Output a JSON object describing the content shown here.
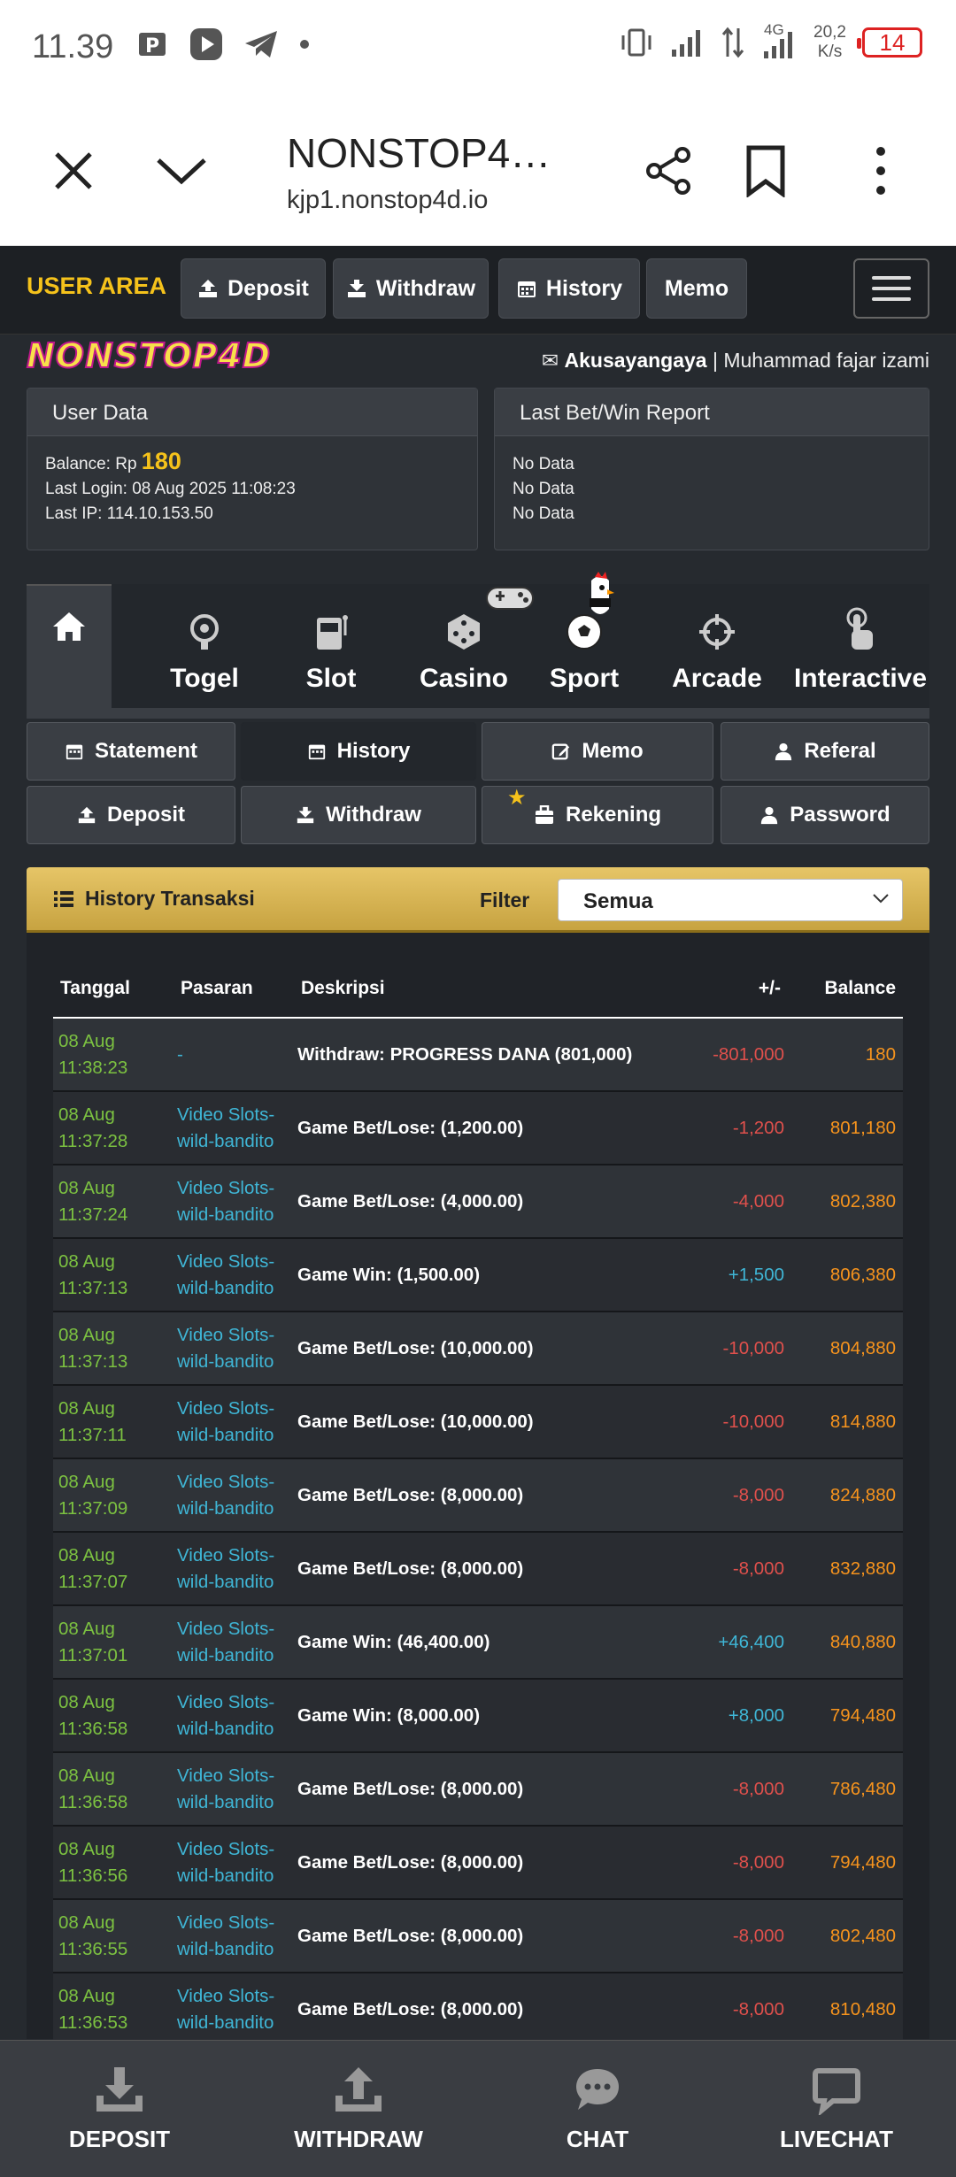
{
  "status_bar": {
    "time": "11.39",
    "net_speed_value": "20,2",
    "net_speed_unit": "K/s",
    "network": "4G",
    "battery": "14"
  },
  "browser": {
    "title": "NONSTOP4…",
    "url": "kjp1.nonstop4d.io"
  },
  "navbar": {
    "user_area": "USER AREA",
    "buttons": [
      {
        "label": "Deposit",
        "icon": "deposit-icon"
      },
      {
        "label": "Withdraw",
        "icon": "withdraw-icon"
      },
      {
        "label": "History",
        "icon": "calendar-icon"
      },
      {
        "label": "Memo"
      }
    ]
  },
  "logo": "NONSTOP4D",
  "user": {
    "username": "Akusayangaya",
    "separator": " | ",
    "fullname": "Muhammad fajar izami"
  },
  "user_data": {
    "title": "User Data",
    "balance_label": "Balance: Rp ",
    "balance_value": "180",
    "last_login": "Last Login: 08 Aug 2025 11:08:23",
    "last_ip": "Last IP: 114.10.153.50"
  },
  "report": {
    "title": "Last Bet/Win Report",
    "lines": [
      "No Data",
      "No Data",
      "No Data"
    ]
  },
  "categories": [
    {
      "label": "",
      "icon": "home-icon"
    },
    {
      "label": "Togel",
      "icon": "lottery-icon"
    },
    {
      "label": "Slot",
      "icon": "slot-machine-icon"
    },
    {
      "label": "Casino",
      "icon": "dice-icon"
    },
    {
      "label": "Sport",
      "icon": "soccer-ball-icon"
    },
    {
      "label": "Arcade",
      "icon": "crosshair-icon"
    },
    {
      "label": "Interactive",
      "icon": "hand-pointer-icon"
    }
  ],
  "tabs": [
    {
      "label": "Statement",
      "icon": "calendar-icon"
    },
    {
      "label": "History",
      "icon": "calendar-icon",
      "active": true
    },
    {
      "label": "Memo",
      "icon": "edit-icon"
    },
    {
      "label": "Referal",
      "icon": "user-icon"
    },
    {
      "label": "Deposit",
      "icon": "deposit-icon"
    },
    {
      "label": "Withdraw",
      "icon": "withdraw-icon"
    },
    {
      "label": "Rekening",
      "icon": "briefcase-icon"
    },
    {
      "label": "Password",
      "icon": "user-icon"
    }
  ],
  "history": {
    "title": "History Transaksi",
    "filter_label": "Filter",
    "filter_value": "Semua",
    "columns": [
      "Tanggal",
      "Pasaran",
      "Deskripsi",
      "+/-",
      "Balance"
    ],
    "rows": [
      {
        "date": "08 Aug",
        "time": "11:38:23",
        "pasaran1": "-",
        "pasaran2": "",
        "desc": "Withdraw: PROGRESS DANA (801,000)",
        "amount": "-801,000",
        "balance": "180"
      },
      {
        "date": "08 Aug",
        "time": "11:37:28",
        "pasaran1": "Video Slots-",
        "pasaran2": "wild-bandito",
        "desc": "Game Bet/Lose: (1,200.00)",
        "amount": "-1,200",
        "balance": "801,180"
      },
      {
        "date": "08 Aug",
        "time": "11:37:24",
        "pasaran1": "Video Slots-",
        "pasaran2": "wild-bandito",
        "desc": "Game Bet/Lose: (4,000.00)",
        "amount": "-4,000",
        "balance": "802,380"
      },
      {
        "date": "08 Aug",
        "time": "11:37:13",
        "pasaran1": "Video Slots-",
        "pasaran2": "wild-bandito",
        "desc": "Game Win: (1,500.00)",
        "amount": "+1,500",
        "balance": "806,380"
      },
      {
        "date": "08 Aug",
        "time": "11:37:13",
        "pasaran1": "Video Slots-",
        "pasaran2": "wild-bandito",
        "desc": "Game Bet/Lose: (10,000.00)",
        "amount": "-10,000",
        "balance": "804,880"
      },
      {
        "date": "08 Aug",
        "time": "11:37:11",
        "pasaran1": "Video Slots-",
        "pasaran2": "wild-bandito",
        "desc": "Game Bet/Lose: (10,000.00)",
        "amount": "-10,000",
        "balance": "814,880"
      },
      {
        "date": "08 Aug",
        "time": "11:37:09",
        "pasaran1": "Video Slots-",
        "pasaran2": "wild-bandito",
        "desc": "Game Bet/Lose: (8,000.00)",
        "amount": "-8,000",
        "balance": "824,880"
      },
      {
        "date": "08 Aug",
        "time": "11:37:07",
        "pasaran1": "Video Slots-",
        "pasaran2": "wild-bandito",
        "desc": "Game Bet/Lose: (8,000.00)",
        "amount": "-8,000",
        "balance": "832,880"
      },
      {
        "date": "08 Aug",
        "time": "11:37:01",
        "pasaran1": "Video Slots-",
        "pasaran2": "wild-bandito",
        "desc": "Game Win: (46,400.00)",
        "amount": "+46,400",
        "balance": "840,880"
      },
      {
        "date": "08 Aug",
        "time": "11:36:58",
        "pasaran1": "Video Slots-",
        "pasaran2": "wild-bandito",
        "desc": "Game Win: (8,000.00)",
        "amount": "+8,000",
        "balance": "794,480"
      },
      {
        "date": "08 Aug",
        "time": "11:36:58",
        "pasaran1": "Video Slots-",
        "pasaran2": "wild-bandito",
        "desc": "Game Bet/Lose: (8,000.00)",
        "amount": "-8,000",
        "balance": "786,480"
      },
      {
        "date": "08 Aug",
        "time": "11:36:56",
        "pasaran1": "Video Slots-",
        "pasaran2": "wild-bandito",
        "desc": "Game Bet/Lose: (8,000.00)",
        "amount": "-8,000",
        "balance": "794,480"
      },
      {
        "date": "08 Aug",
        "time": "11:36:55",
        "pasaran1": "Video Slots-",
        "pasaran2": "wild-bandito",
        "desc": "Game Bet/Lose: (8,000.00)",
        "amount": "-8,000",
        "balance": "802,480"
      },
      {
        "date": "08 Aug",
        "time": "11:36:53",
        "pasaran1": "Video Slots-",
        "pasaran2": "wild-bandito",
        "desc": "Game Bet/Lose: (8,000.00)",
        "amount": "-8,000",
        "balance": "810,480"
      }
    ]
  },
  "bottom_nav": [
    {
      "label": "DEPOSIT",
      "icon": "download-icon"
    },
    {
      "label": "WITHDRAW",
      "icon": "upload-icon"
    },
    {
      "label": "CHAT",
      "icon": "chat-bubble-icon"
    },
    {
      "label": "LIVECHAT",
      "icon": "livechat-icon"
    }
  ],
  "colors": {
    "accent": "#f5c21b",
    "date": "#7cc241",
    "pasaran": "#3fb6d6",
    "negative": "#e0504c",
    "positive": "#3fb6d6",
    "balance": "#f7941d",
    "history_header": "#d4b252"
  }
}
